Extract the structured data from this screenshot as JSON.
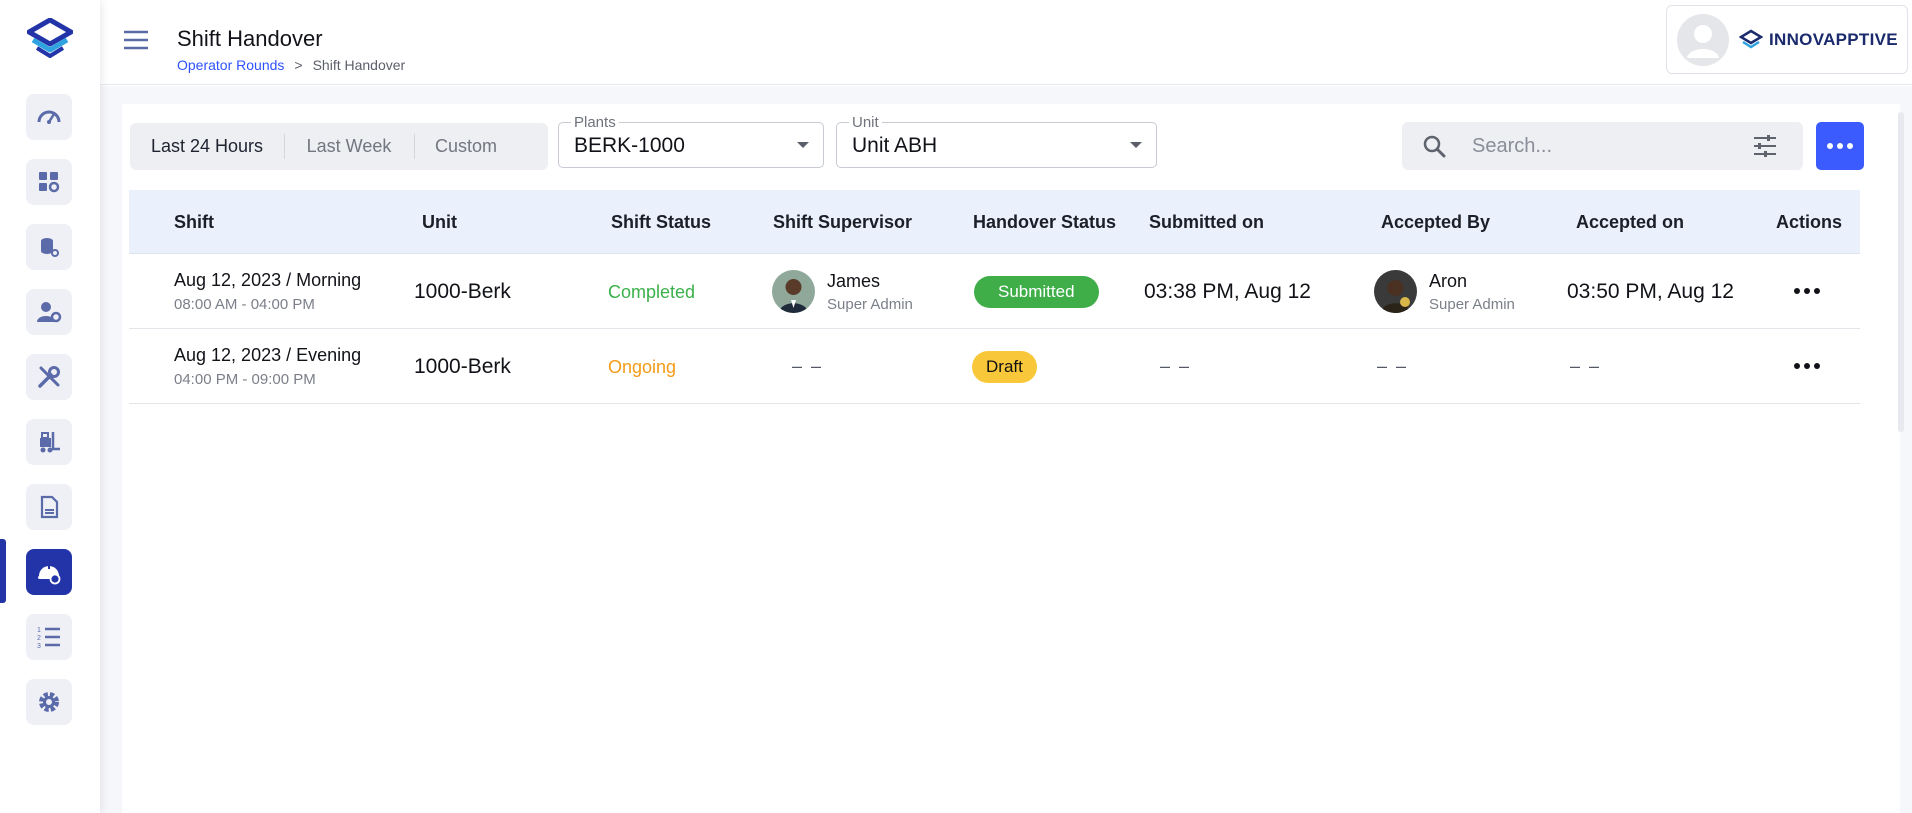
{
  "header": {
    "title": "Shift Handover",
    "breadcrumb": [
      "Operator Rounds",
      ">",
      "Shift Handover"
    ],
    "brand": "INNOVAPPTIVE"
  },
  "sidebar": {
    "items": [
      {
        "icon": "gauge-icon"
      },
      {
        "icon": "dashboard-settings-icon"
      },
      {
        "icon": "database-settings-icon"
      },
      {
        "icon": "user-settings-icon"
      },
      {
        "icon": "tools-icon"
      },
      {
        "icon": "forklift-icon"
      },
      {
        "icon": "document-icon"
      },
      {
        "icon": "hard-hat-icon",
        "active": true
      },
      {
        "icon": "numbered-list-icon"
      },
      {
        "icon": "gear-icon"
      }
    ]
  },
  "filters": {
    "range_options": [
      "Last 24 Hours",
      "Last Week",
      "Custom"
    ],
    "range_selected": "Last 24 Hours",
    "plants_label": "Plants",
    "plants_value": "BERK-1000",
    "unit_label": "Unit",
    "unit_value": "Unit ABH",
    "search_placeholder": "Search..."
  },
  "table": {
    "columns": [
      "Shift",
      "Unit",
      "Shift Status",
      "Shift Supervisor",
      "Handover Status",
      "Submitted on",
      "Accepted By",
      "Accepted on",
      "Actions"
    ],
    "rows": [
      {
        "shift": "Aug 12, 2023 / Morning",
        "shift_time": "08:00 AM - 04:00 PM",
        "unit": "1000-Berk",
        "shift_status": "Completed",
        "supervisor_name": "James",
        "supervisor_role": "Super Admin",
        "handover_status": "Submitted",
        "submitted_on": "03:38 PM, Aug 12",
        "accepted_by_name": "Aron",
        "accepted_by_role": "Super Admin",
        "accepted_on": "03:50 PM, Aug 12"
      },
      {
        "shift": "Aug 12, 2023 / Evening",
        "shift_time": "04:00 PM - 09:00 PM",
        "unit": "1000-Berk",
        "shift_status": "Ongoing",
        "supervisor_name": "– –",
        "handover_status": "Draft",
        "submitted_on": "– –",
        "accepted_by_name": "– –",
        "accepted_on": "– –"
      }
    ]
  },
  "colors": {
    "accent": "#2234a8",
    "primary_button": "#3b5bff",
    "completed": "#3ab04a",
    "ongoing": "#f39b18",
    "submitted_badge": "#3fae49",
    "draft_badge": "#f8c73a"
  }
}
